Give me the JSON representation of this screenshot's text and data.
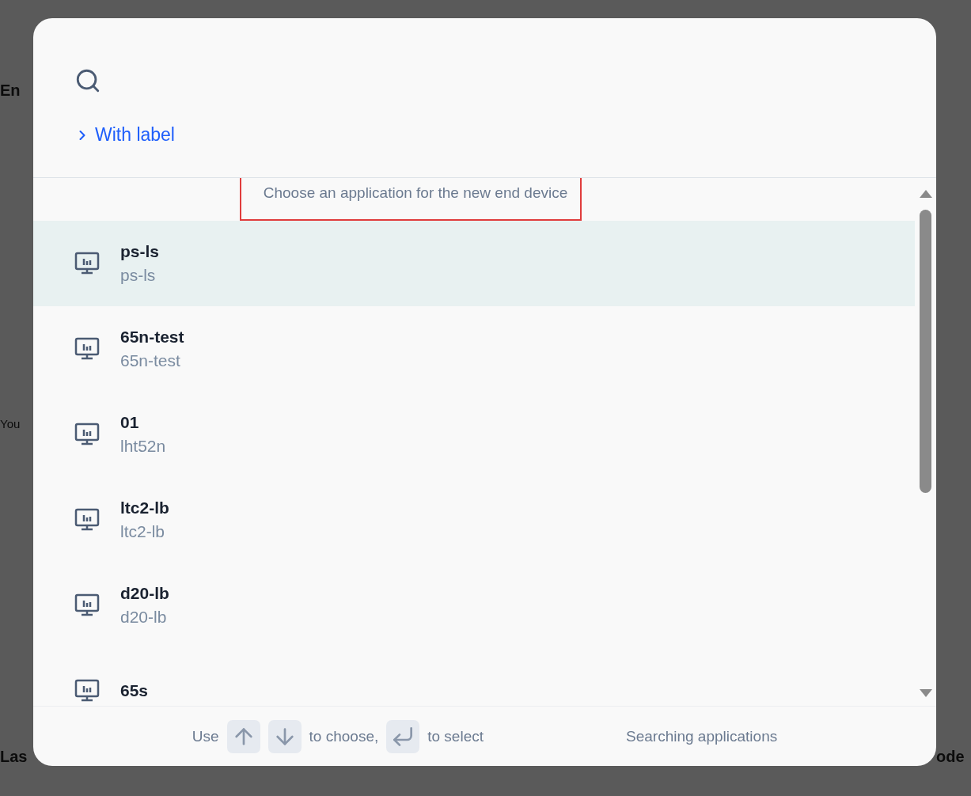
{
  "background": {
    "left_texts": [
      {
        "text": "En",
        "kind": "heading"
      },
      {
        "text": "You",
        "kind": "body"
      },
      {
        "text": "Las",
        "kind": "heading"
      }
    ],
    "right_texts": [
      {
        "text": "ode",
        "kind": "heading"
      }
    ]
  },
  "label_toggle": {
    "label": "With label",
    "expanded": false
  },
  "hint": "Choose an application for the new end device",
  "applications": [
    {
      "name": "ps-ls",
      "id": "ps-ls",
      "selected": true
    },
    {
      "name": "65n-test",
      "id": "65n-test",
      "selected": false
    },
    {
      "name": "01",
      "id": "lht52n",
      "selected": false
    },
    {
      "name": "ltc2-lb",
      "id": "ltc2-lb",
      "selected": false
    },
    {
      "name": "d20-lb",
      "id": "d20-lb",
      "selected": false
    },
    {
      "name": "65s",
      "selected": false
    }
  ],
  "footer": {
    "use": "Use",
    "choose": "to choose,",
    "select": "to select",
    "status": "Searching applications"
  }
}
